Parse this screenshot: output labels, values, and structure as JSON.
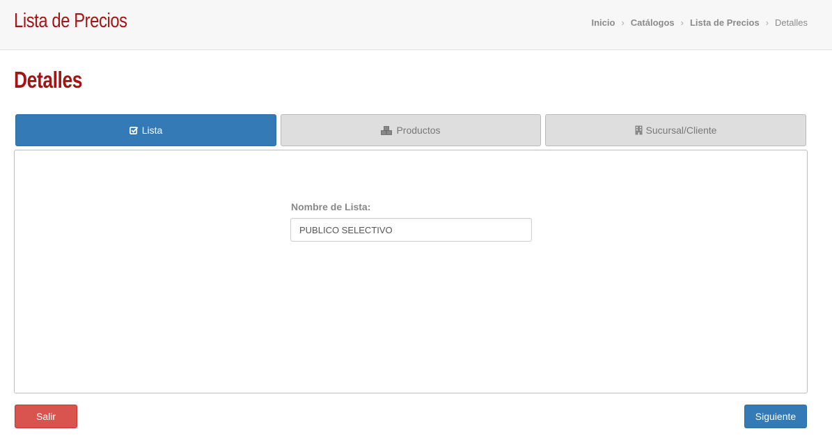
{
  "header": {
    "title": "Lista de Precios",
    "breadcrumb": [
      {
        "label": "Inicio"
      },
      {
        "label": "Catálogos"
      },
      {
        "label": "Lista de Precios"
      },
      {
        "label": "Detalles"
      }
    ]
  },
  "page": {
    "title": "Detalles"
  },
  "tabs": [
    {
      "label": "Lista",
      "icon": "check-square-icon",
      "active": true
    },
    {
      "label": "Productos",
      "icon": "cubes-icon",
      "active": false
    },
    {
      "label": "Sucursal/Cliente",
      "icon": "building-icon",
      "active": false
    }
  ],
  "form": {
    "list_name_label": "Nombre de Lista:",
    "list_name_value": "PUBLICO SELECTIVO"
  },
  "actions": {
    "exit_label": "Salir",
    "next_label": "Siguiente"
  },
  "colors": {
    "brand_red": "#a31515",
    "primary": "#337ab7",
    "danger": "#d9534f"
  }
}
